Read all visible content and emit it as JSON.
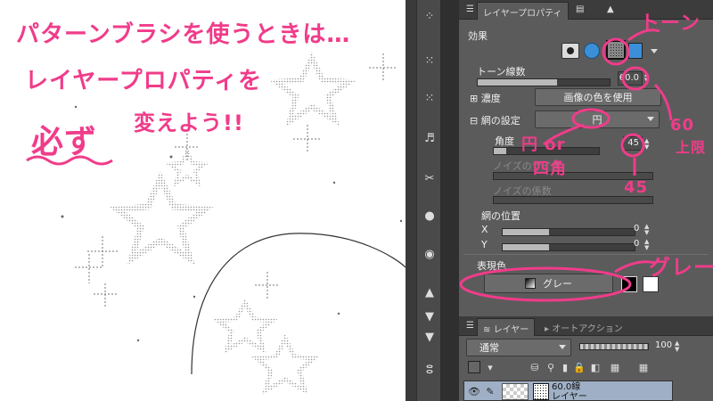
{
  "annotations": {
    "line1": "パターンブラシを使うときは…",
    "line2": "レイヤープロパティを",
    "line3_emph": "必ず",
    "line3_rest": "変えよう!!",
    "tone_note": "トーン",
    "max_note": "60",
    "max_note2": "上限",
    "shape_note1": "円 or",
    "shape_note2": "四角",
    "angle_note": "45",
    "gray_note": "グレー",
    "accent_color": "#f03c8a"
  },
  "properties_panel": {
    "tabs": [
      "レイヤープロパティ"
    ],
    "effect_label": "効果",
    "tone_lines_label": "トーン線数",
    "tone_lines_value": "60.0",
    "density_label": "濃度",
    "density_value": "画像の色を使用",
    "screen_settings_label": "網の設定",
    "screen_shape_value": "円",
    "angle_label": "角度",
    "angle_value": "45",
    "noise_size_label": "ノイズのサイズ",
    "noise_factor_label": "ノイズの係数",
    "screen_position_label": "網の位置",
    "x_label": "X",
    "y_label": "Y",
    "x_value": "0",
    "y_value": "0",
    "expression_color_label": "表現色",
    "expression_color_value": "グレー"
  },
  "layer_panel": {
    "tabs": [
      "レイヤー",
      "オートアクション"
    ],
    "blend_mode": "通常",
    "opacity": "100",
    "layer_name_line1": "60.0線",
    "layer_name_line2": "レイヤー"
  }
}
